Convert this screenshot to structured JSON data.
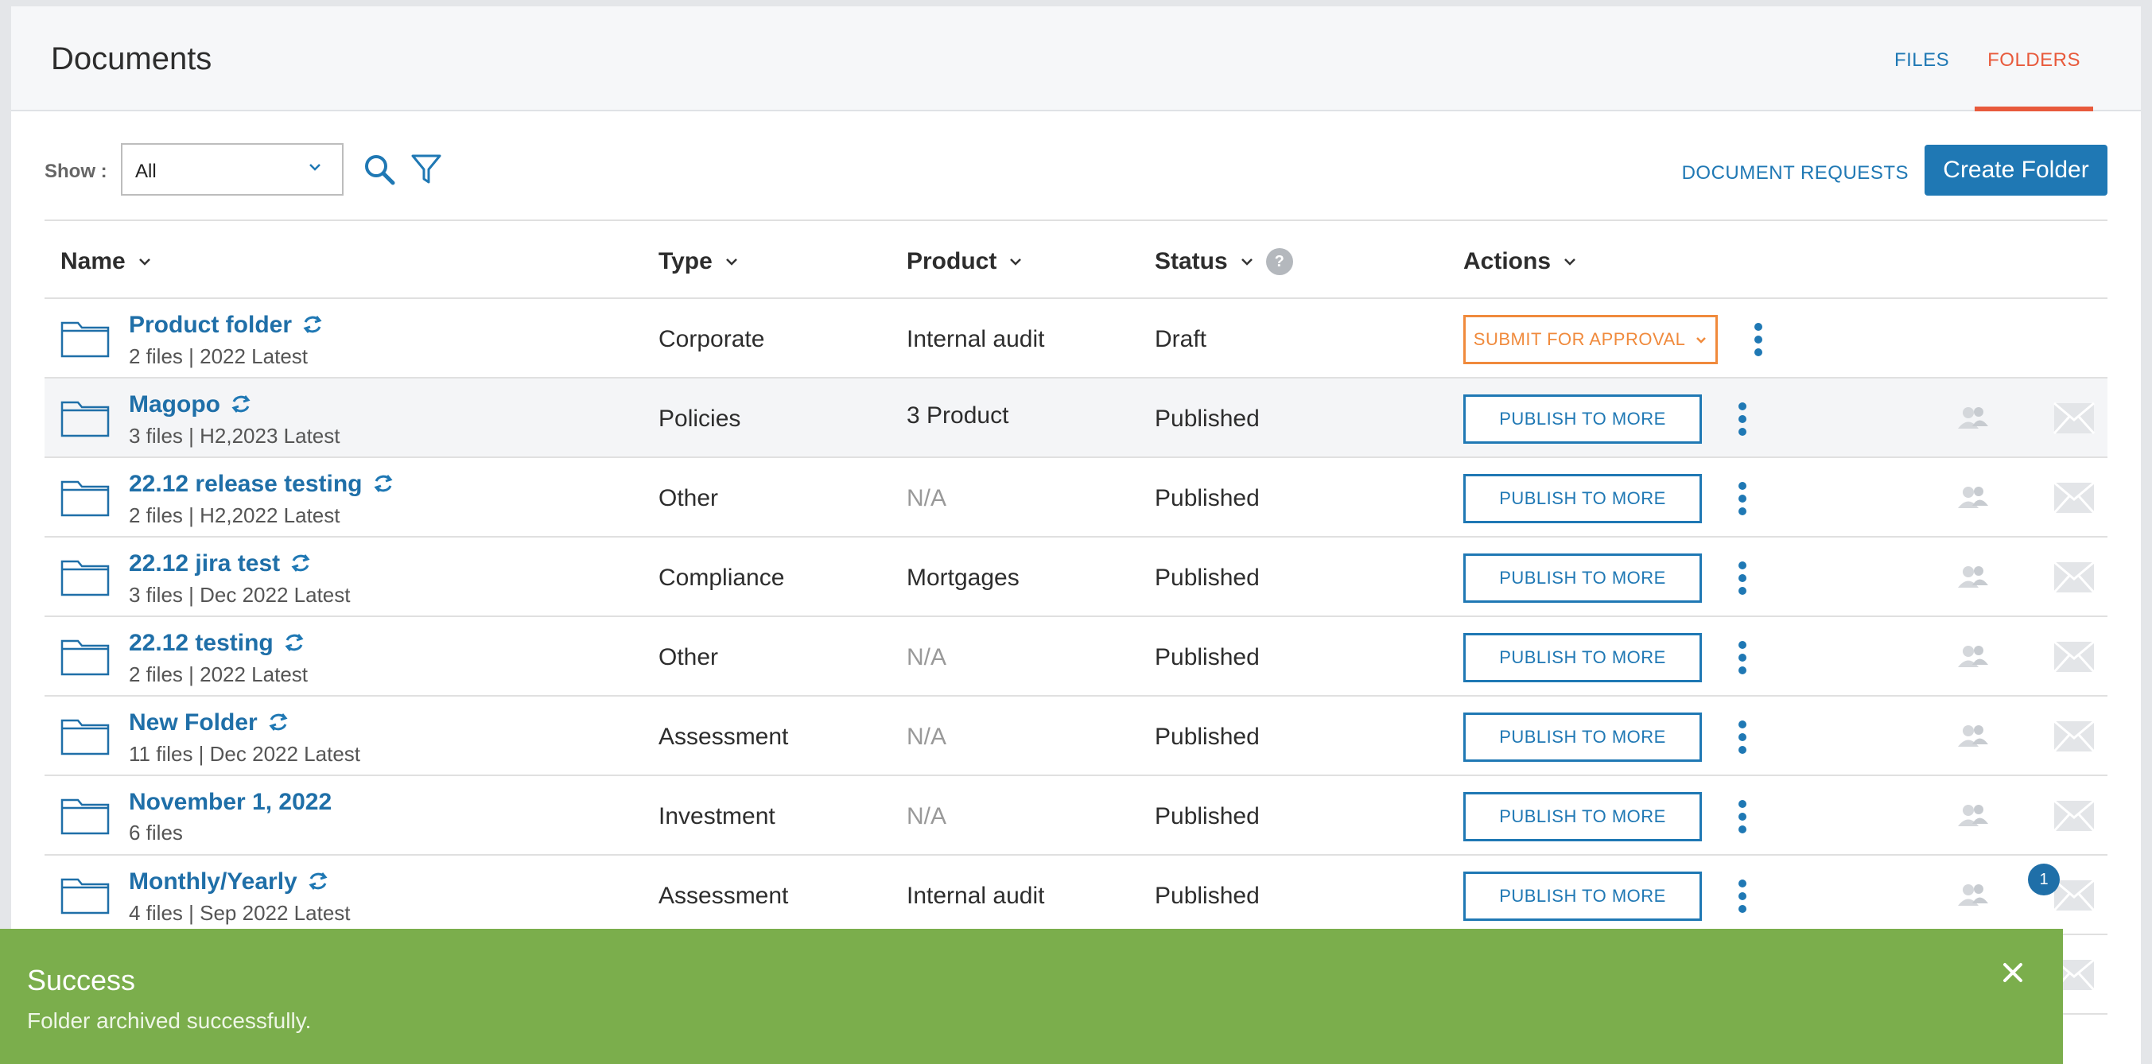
{
  "header": {
    "title": "Documents",
    "tabs": [
      {
        "label": "FILES",
        "active": false
      },
      {
        "label": "FOLDERS",
        "active": true
      }
    ]
  },
  "toolbar": {
    "show_label": "Show :",
    "show_value": "All",
    "document_requests_label": "DOCUMENT REQUESTS",
    "create_folder_label": "Create Folder"
  },
  "table": {
    "columns": {
      "name": "Name",
      "type": "Type",
      "product": "Product",
      "status": "Status",
      "actions": "Actions"
    },
    "help_glyph": "?",
    "rows": [
      {
        "name": "Product folder",
        "meta": "2 files | 2022 Latest",
        "type": "Corporate",
        "product": "Internal audit",
        "status": "Draft",
        "action": "SUBMIT FOR APPROVAL"
      },
      {
        "name": "Magopo",
        "meta": "3 files | H2,2023 Latest",
        "type": "Policies",
        "product": "3 Product",
        "status": "Published",
        "action": "PUBLISH TO MORE"
      },
      {
        "name": "22.12 release testing",
        "meta": "2 files | H2,2022 Latest",
        "type": "Other",
        "product": "N/A",
        "status": "Published",
        "action": "PUBLISH TO MORE"
      },
      {
        "name": "22.12 jira test",
        "meta": "3 files | Dec 2022 Latest",
        "type": "Compliance",
        "product": "Mortgages",
        "status": "Published",
        "action": "PUBLISH TO MORE"
      },
      {
        "name": "22.12 testing",
        "meta": "2 files | 2022 Latest",
        "type": "Other",
        "product": "N/A",
        "status": "Published",
        "action": "PUBLISH TO MORE"
      },
      {
        "name": "New Folder",
        "meta": "11 files | Dec 2022 Latest",
        "type": "Assessment",
        "product": "N/A",
        "status": "Published",
        "action": "PUBLISH TO MORE"
      },
      {
        "name": "November 1, 2022",
        "meta": "6 files",
        "type": "Investment",
        "product": "N/A",
        "status": "Published",
        "action": "PUBLISH TO MORE"
      },
      {
        "name": "Monthly/Yearly",
        "meta": "4 files | Sep 2022 Latest",
        "type": "Assessment",
        "product": "Internal audit",
        "status": "Published",
        "action": "PUBLISH TO MORE",
        "badge": "1"
      }
    ]
  },
  "toast": {
    "title": "Success",
    "message": "Folder archived successfully."
  },
  "colors": {
    "accent": "#1f78b4",
    "active_tab": "#e85a3c",
    "submit": "#f08a3c",
    "toast": "#7bae4c"
  }
}
